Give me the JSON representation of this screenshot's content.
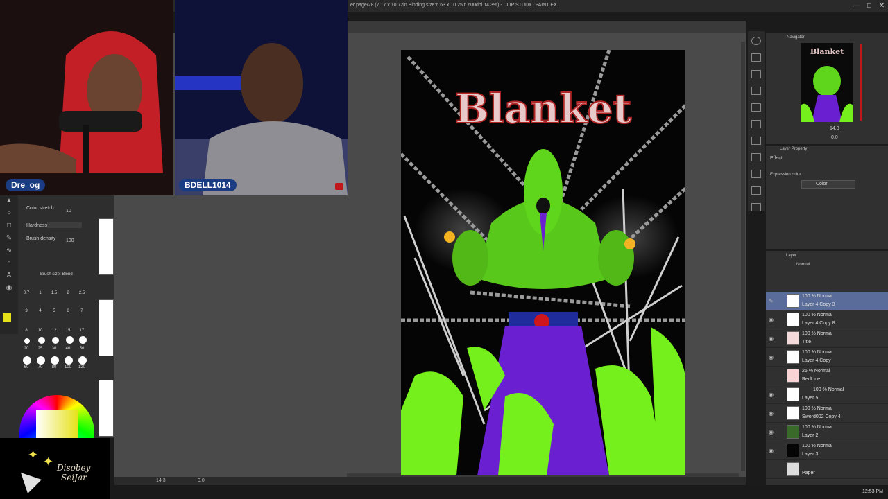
{
  "app": {
    "title": "er page/28 (7.17 x 10.72in Binding size:6.63 x 10.25in 600dpi 14.3%) - CLIP STUDIO PAINT EX"
  },
  "streamers": {
    "cam1_name": "Dre_og",
    "cam2_name": "BDELL1014"
  },
  "tool_property": {
    "color_stretch_label": "Color stretch",
    "color_stretch_value": "10",
    "hardness_label": "Hardness",
    "brush_density_label": "Brush density",
    "brush_density_value": "100",
    "brush_size_title": "Brush size: Blend"
  },
  "brush_sizes": {
    "row1": [
      "0.7",
      "1",
      "1.5",
      "2",
      "2.5"
    ],
    "row2": [
      "3",
      "4",
      "5",
      "6",
      "7"
    ],
    "row3": [
      "8",
      "10",
      "12",
      "15",
      "17"
    ],
    "row4": [
      "20",
      "25",
      "30",
      "40",
      "50"
    ],
    "row5": [
      "60",
      "70",
      "80",
      "100",
      "120"
    ]
  },
  "artwork": {
    "title_text": "Blanket"
  },
  "navigator": {
    "title": "Navigator",
    "zoom": "14.3",
    "rotation": "0.0"
  },
  "layer_property": {
    "title": "Layer Property",
    "effect_label": "Effect",
    "expression_color_label": "Expression color",
    "color_option": "Color"
  },
  "layer_panel": {
    "title": "Layer",
    "blend_mode": "Normal",
    "layers": [
      {
        "blend": "100 % Normal",
        "name": "Layer 4 Copy 3"
      },
      {
        "blend": "100 % Normal",
        "name": "Layer 4 Copy 8"
      },
      {
        "blend": "100 % Normal",
        "name": "Title"
      },
      {
        "blend": "100 % Normal",
        "name": "Layer 4 Copy"
      },
      {
        "blend": "26 % Normal",
        "name": "RedLine"
      },
      {
        "blend": "100 % Normal",
        "name": "Layer 5"
      },
      {
        "blend": "100 % Normal",
        "name": "Sword002 Copy 4"
      },
      {
        "blend": "100 % Normal",
        "name": "Layer 2"
      },
      {
        "blend": "100 % Normal",
        "name": "Layer 3"
      },
      {
        "blend": "",
        "name": "Paper"
      }
    ]
  },
  "canvas_toolbar": {
    "zoom": "14.3",
    "rotation": "0.0"
  },
  "logo": {
    "line1": "Disobey",
    "line2": "SeiJar"
  },
  "status": {
    "clock": "12:53 PM"
  },
  "colors": {
    "accent_selected": "#5a6d9a",
    "hulk_green": "#5fd61c",
    "robe_purple": "#6a1fd0"
  }
}
